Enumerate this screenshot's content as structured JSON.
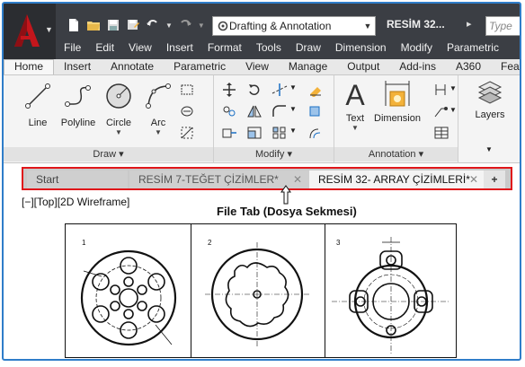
{
  "titlebar": {
    "workspace": "Drafting & Annotation",
    "document_title": "RESİM 32...",
    "search_placeholder": "Type"
  },
  "menubar": [
    "File",
    "Edit",
    "View",
    "Insert",
    "Format",
    "Tools",
    "Draw",
    "Dimension",
    "Modify",
    "Parametric"
  ],
  "ribbon_tabs": [
    "Home",
    "Insert",
    "Annotate",
    "Parametric",
    "View",
    "Manage",
    "Output",
    "Add-ins",
    "A360",
    "Featured"
  ],
  "ribbon_active_tab": "Home",
  "panels": {
    "draw": {
      "title": "Draw",
      "tools": [
        "Line",
        "Polyline",
        "Circle",
        "Arc"
      ]
    },
    "modify": {
      "title": "Modify"
    },
    "annotation": {
      "title": "Annotation",
      "tools": [
        "Text",
        "Dimension"
      ]
    },
    "layers": {
      "title": "Layers"
    }
  },
  "file_tabs": {
    "start": "Start",
    "tab1": "RESİM 7-TEĞET ÇİZİMLER*",
    "tab2": "RESİM 32- ARRAY ÇİZİMLERİ*",
    "plus": "+"
  },
  "viewport_label": "[−][Top][2D Wireframe]",
  "annotation_text": "File Tab (Dosya Sekmesi)",
  "drawing_numbers": [
    "1",
    "2",
    "3"
  ],
  "colors": {
    "titlebar_bg": "#3b3e44",
    "autocad_red": "#c4161c",
    "highlight_border": "#e0161a",
    "frame_blue": "#2f7dc9"
  }
}
